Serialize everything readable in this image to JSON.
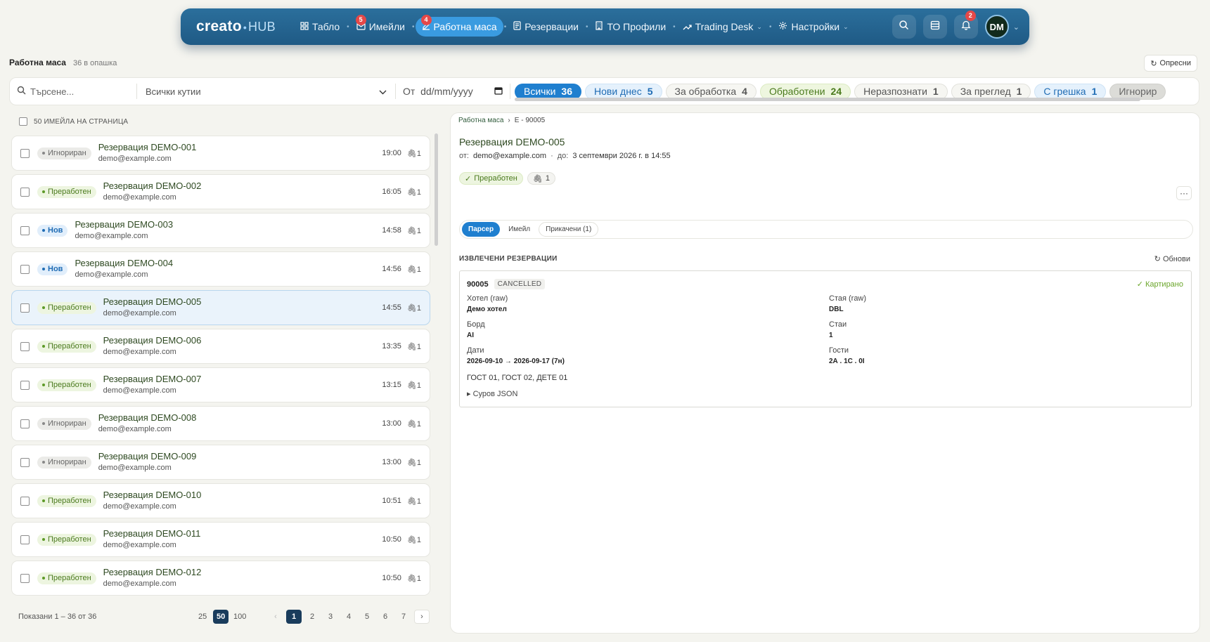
{
  "nav": {
    "logo_main": "creato",
    "logo_dot": "•",
    "logo_hub": "HUB",
    "items": [
      {
        "label": "Табло",
        "icon": "dashboard-icon"
      },
      {
        "label": "Имейли",
        "badge": "5",
        "icon": "mail-icon"
      },
      {
        "label": "Работна маса",
        "badge": "4",
        "icon": "workbench-icon",
        "active": true
      },
      {
        "label": "Резервации",
        "icon": "document-icon"
      },
      {
        "label": "ТО Профили",
        "icon": "building-icon"
      },
      {
        "label": "Trading Desk",
        "icon": "trend-icon"
      },
      {
        "label": "Настройки",
        "icon": "gear-icon"
      }
    ],
    "notifications_badge": "2",
    "avatar": "DM"
  },
  "subheader": {
    "title": "Работна маса",
    "queue": "36 в опашка",
    "refresh": "Опресни"
  },
  "filters": {
    "search_placeholder": "Търсене...",
    "mailbox": "Всички кутии",
    "date_label": "От",
    "date_placeholder": "dd/mm/yyyy",
    "chips": [
      {
        "label": "Всички",
        "count": "36"
      },
      {
        "label": "Нови днес",
        "count": "5"
      },
      {
        "label": "За обработка",
        "count": "4"
      },
      {
        "label": "Обработени",
        "count": "24"
      },
      {
        "label": "Неразпознати",
        "count": "1"
      },
      {
        "label": "За преглед",
        "count": "1"
      },
      {
        "label": "С грешка",
        "count": "1"
      },
      {
        "label": "Игнорир",
        "count": ""
      }
    ]
  },
  "list": {
    "per_page_label": "50 ИМЕЙЛА НА СТРАНИЦА",
    "rows": [
      {
        "status": "Игнориран",
        "title": "Резервация DEMO-001",
        "email": "demo@example.com",
        "time": "19:00",
        "attachments": "1"
      },
      {
        "status": "Преработен",
        "title": "Резервация DEMO-002",
        "email": "demo@example.com",
        "time": "16:05",
        "attachments": "1"
      },
      {
        "status": "Нов",
        "title": "Резервация DEMO-003",
        "email": "demo@example.com",
        "time": "14:58",
        "attachments": "1"
      },
      {
        "status": "Нов",
        "title": "Резервация DEMO-004",
        "email": "demo@example.com",
        "time": "14:56",
        "attachments": "1"
      },
      {
        "status": "Преработен",
        "title": "Резервация DEMO-005",
        "email": "demo@example.com",
        "time": "14:55",
        "attachments": "1"
      },
      {
        "status": "Преработен",
        "title": "Резервация DEMO-006",
        "email": "demo@example.com",
        "time": "13:35",
        "attachments": "1"
      },
      {
        "status": "Преработен",
        "title": "Резервация DEMO-007",
        "email": "demo@example.com",
        "time": "13:15",
        "attachments": "1"
      },
      {
        "status": "Игнориран",
        "title": "Резервация DEMO-008",
        "email": "demo@example.com",
        "time": "13:00",
        "attachments": "1"
      },
      {
        "status": "Игнориран",
        "title": "Резервация DEMO-009",
        "email": "demo@example.com",
        "time": "13:00",
        "attachments": "1"
      },
      {
        "status": "Преработен",
        "title": "Резервация DEMO-010",
        "email": "demo@example.com",
        "time": "10:51",
        "attachments": "1"
      },
      {
        "status": "Преработен",
        "title": "Резервация DEMO-011",
        "email": "demo@example.com",
        "time": "10:50",
        "attachments": "1"
      },
      {
        "status": "Преработен",
        "title": "Резервация DEMO-012",
        "email": "demo@example.com",
        "time": "10:50",
        "attachments": "1"
      }
    ]
  },
  "pager": {
    "info": "Показани 1 – 36 от 36",
    "sizes": [
      "25",
      "50",
      "100"
    ],
    "pages": [
      "1",
      "2",
      "3",
      "4",
      "5",
      "6",
      "7"
    ]
  },
  "detail": {
    "breadcrumb": [
      "Работна маса",
      "E - 90005"
    ],
    "title": "Резервация DEMO-005",
    "from_label": "от:",
    "from": "demo@example.com",
    "to_label": "до:",
    "date": "3 септември 2026 г. в 14:55",
    "status": "Преработен",
    "attachments": "1",
    "more": "···",
    "tabs": [
      "Парсер",
      "Имейл",
      "Прикачени (1)"
    ],
    "section": "ИЗВЛЕЧЕНИ РЕЗЕРВАЦИИ",
    "refresh": "Обнови",
    "reservation": {
      "id": "90005",
      "status": "CANCELLED",
      "mapped": "Картирано",
      "hotel_label": "Хотел (raw)",
      "hotel": "Демо хотел",
      "room_label": "Стая (raw)",
      "room": "DBL",
      "board_label": "Борд",
      "board": "AI",
      "rooms_label": "Стаи",
      "rooms": "1",
      "dates_label": "Дати",
      "dates": "2026-09-10 → 2026-09-17 (7н)",
      "guests_label": "Гости",
      "guests": "2А . 1С . 0I",
      "guest_names": "ГОСТ 01, ГОСТ 02, ДЕТЕ 01",
      "raw_json": "Суров JSON"
    }
  }
}
